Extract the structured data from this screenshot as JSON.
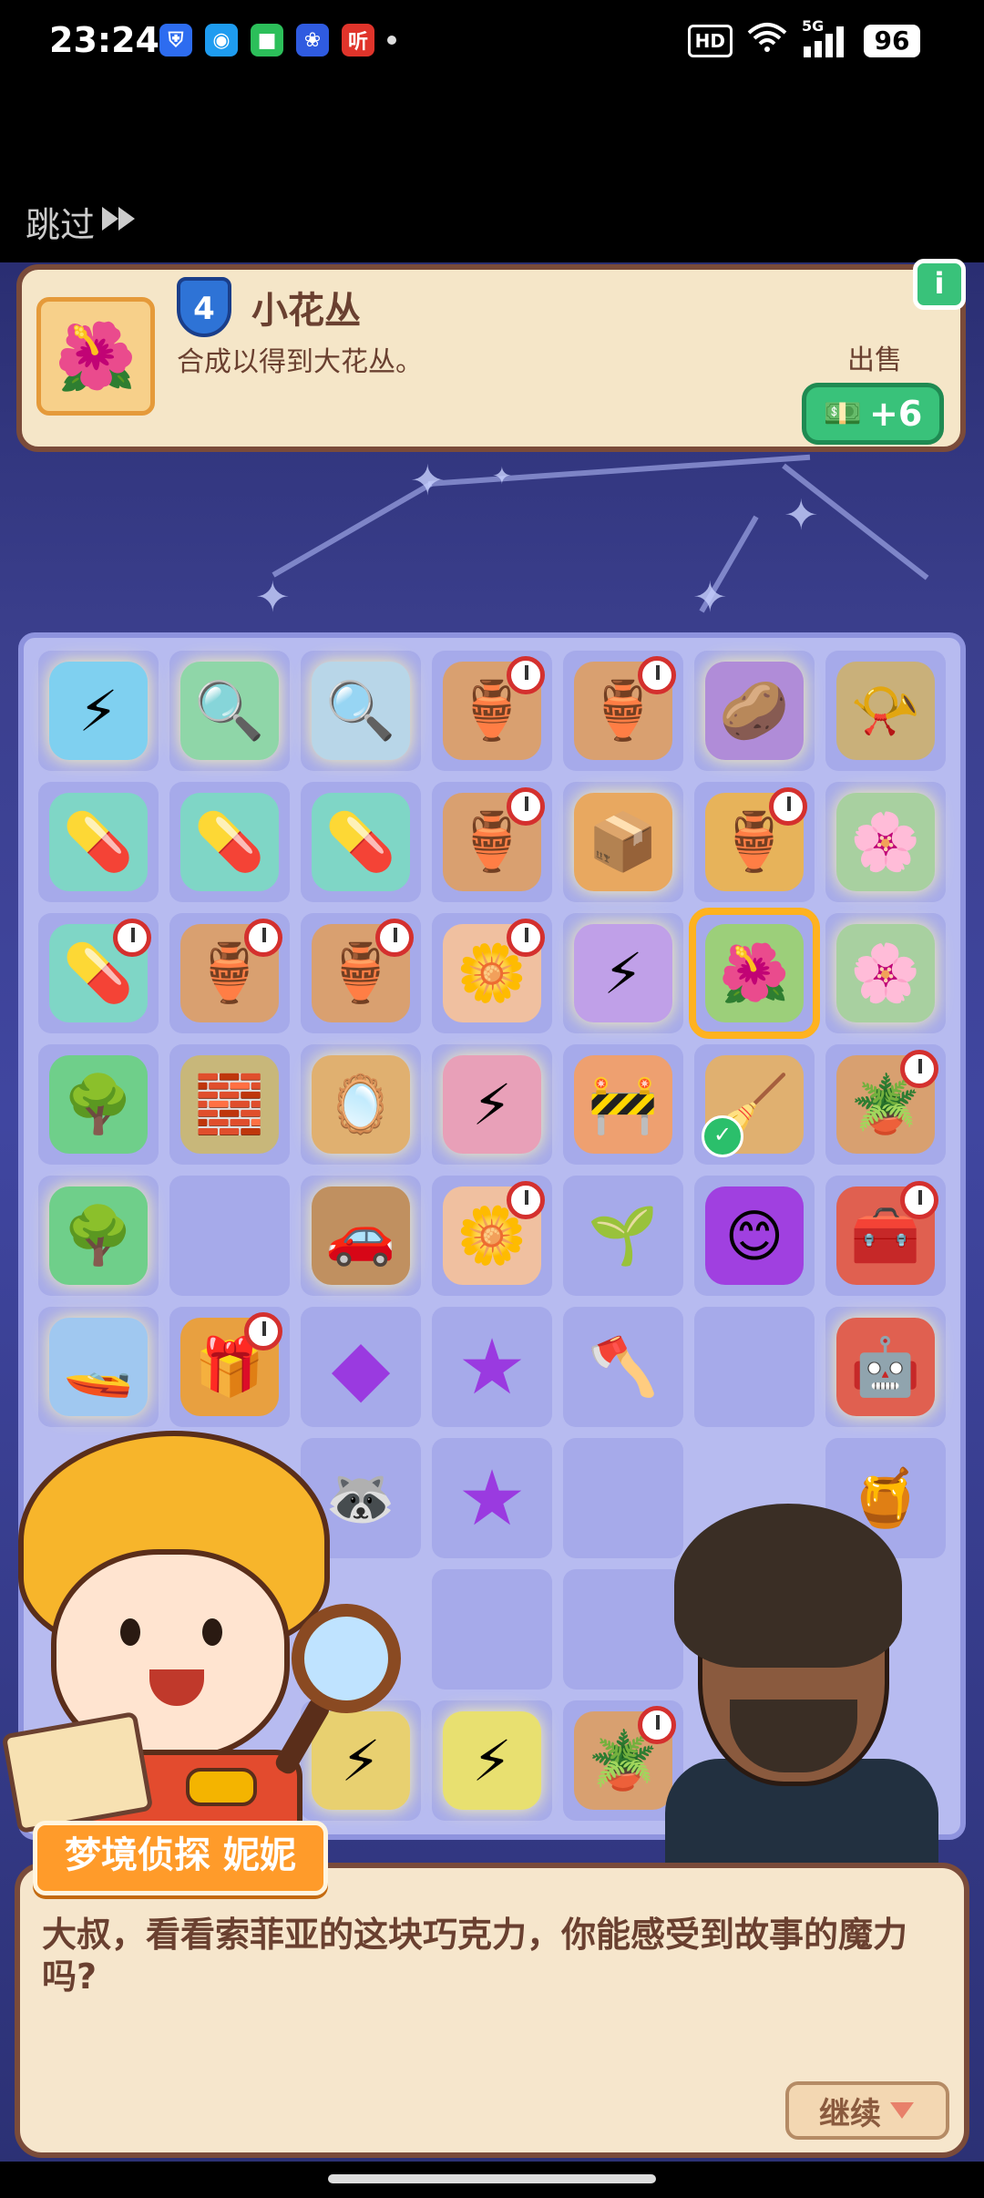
{
  "status_bar": {
    "time": "23:24",
    "hd": "HD",
    "network": "5G",
    "battery": "96",
    "apps": [
      {
        "icon": "shield-app-icon",
        "color": "#2d6cf0",
        "glyph": "⛨"
      },
      {
        "icon": "penguin-app-icon",
        "color": "#1e9cf0",
        "glyph": "◉"
      },
      {
        "icon": "chat-app-icon",
        "color": "#2cbf5a",
        "glyph": "■"
      },
      {
        "icon": "paw-app-icon",
        "color": "#2f5be0",
        "glyph": "❀"
      },
      {
        "icon": "listen-app-icon",
        "color": "#e0342b",
        "glyph": "听"
      }
    ]
  },
  "skip_label": "跳过",
  "info_panel": {
    "level": "4",
    "title": "小花丛",
    "description": "合成以得到大花丛。",
    "sell_label": "出售",
    "sell_value": "+6",
    "info_button": "i"
  },
  "board": {
    "rows": [
      [
        {
          "name": "power-crate",
          "glyph": "⚡",
          "bg": "#7fd0f0",
          "locked": true
        },
        {
          "name": "map-table",
          "glyph": "🔍",
          "bg": "#8fd6a8",
          "locked": true
        },
        {
          "name": "clue-board",
          "glyph": "🔍",
          "bg": "#b8d6e8",
          "locked": true
        },
        {
          "name": "pottery-cart",
          "glyph": "🏺",
          "bg": "#d9a070",
          "timer": true
        },
        {
          "name": "pottery-cart",
          "glyph": "🏺",
          "bg": "#d9a070",
          "timer": true
        },
        {
          "name": "potato-orb",
          "glyph": "🥔",
          "bg": "#b08cd8",
          "locked": true
        },
        {
          "name": "horn",
          "glyph": "📯",
          "bg": "#c9b07a"
        }
      ],
      [
        {
          "name": "medicine-kit",
          "glyph": "💊",
          "bg": "#7fd6c6"
        },
        {
          "name": "medicine-kit",
          "glyph": "💊",
          "bg": "#7fd6c6"
        },
        {
          "name": "medicine-kit",
          "glyph": "💊",
          "bg": "#7fd6c6"
        },
        {
          "name": "pottery-cart",
          "glyph": "🏺",
          "bg": "#d9a070",
          "timer": true
        },
        {
          "name": "crate-stack",
          "glyph": "📦",
          "bg": "#e8a860",
          "locked": true
        },
        {
          "name": "gold-vase",
          "glyph": "🏺",
          "bg": "#e7b35a",
          "timer": true
        },
        {
          "name": "pink-flower-tree",
          "glyph": "🌸",
          "bg": "#a8d0a0",
          "locked": true
        }
      ],
      [
        {
          "name": "medicine-kit",
          "glyph": "💊",
          "bg": "#7fd6c6",
          "timer": true
        },
        {
          "name": "pottery-cart",
          "glyph": "🏺",
          "bg": "#d9a070",
          "timer": true
        },
        {
          "name": "pottery-cart",
          "glyph": "🏺",
          "bg": "#d9a070",
          "timer": true
        },
        {
          "name": "flower-pot",
          "glyph": "🌼",
          "bg": "#f0c0a0",
          "timer": true
        },
        {
          "name": "power-disc",
          "glyph": "⚡",
          "bg": "#c0a0e8",
          "locked": true
        },
        {
          "name": "small-bush",
          "glyph": "🌺",
          "bg": "#9ccf7a",
          "selected": true
        },
        {
          "name": "pink-flower-tree",
          "glyph": "🌸",
          "bg": "#a8d0a0",
          "locked": true
        }
      ],
      [
        {
          "name": "blossom-tree",
          "glyph": "🌳",
          "bg": "#6fcf8a"
        },
        {
          "name": "sandbag-pile",
          "glyph": "🧱",
          "bg": "#c8b77a"
        },
        {
          "name": "mirror-pair",
          "glyph": "🪞",
          "bg": "#e0b070",
          "locked": true
        },
        {
          "name": "power-orb",
          "glyph": "⚡",
          "bg": "#e8a0b8",
          "locked": true
        },
        {
          "name": "road-barrier",
          "glyph": "🚧",
          "bg": "#eea070"
        },
        {
          "name": "broom",
          "glyph": "🧹",
          "bg": "#e0b070",
          "check": true
        },
        {
          "name": "plant-pot",
          "glyph": "🪴",
          "bg": "#d8a070",
          "timer": true
        }
      ],
      [
        {
          "name": "blossom-tree",
          "glyph": "🌳",
          "bg": "#6fcf8a",
          "locked": true
        },
        {
          "name": "empty",
          "glyph": "",
          "bg": ""
        },
        {
          "name": "toy-car",
          "glyph": "🚗",
          "bg": "#c09060",
          "locked": true
        },
        {
          "name": "flower-pot",
          "glyph": "🌼",
          "bg": "#f0c0a0",
          "timer": true
        },
        {
          "name": "sprout",
          "glyph": "🌱",
          "bg": ""
        },
        {
          "name": "purple-blob",
          "glyph": "😊",
          "bg": "#a040e0"
        },
        {
          "name": "tool-box",
          "glyph": "🧰",
          "bg": "#e06050",
          "timer": true
        }
      ],
      [
        {
          "name": "jet-ski",
          "glyph": "🚤",
          "bg": "#a0c8f0",
          "locked": true
        },
        {
          "name": "treasure-chest",
          "glyph": "🎁",
          "bg": "#e8a040",
          "timer": true
        },
        {
          "name": "purple-gem",
          "glyph": "◆",
          "bg": ""
        },
        {
          "name": "purple-star",
          "glyph": "★",
          "bg": ""
        },
        {
          "name": "axe",
          "glyph": "🪓",
          "bg": ""
        },
        {
          "name": "empty",
          "glyph": "",
          "bg": ""
        },
        {
          "name": "red-robot",
          "glyph": "🤖",
          "bg": "#e06050",
          "locked": true
        }
      ],
      [
        {
          "name": "hidden",
          "glyph": "",
          "bg": ""
        },
        {
          "name": "hidden",
          "glyph": "",
          "bg": ""
        },
        {
          "name": "red-panda",
          "glyph": "🦝",
          "bg": ""
        },
        {
          "name": "purple-star-face",
          "glyph": "★",
          "bg": ""
        },
        {
          "name": "empty",
          "glyph": "",
          "bg": ""
        },
        {
          "name": "hidden",
          "glyph": "",
          "bg": ""
        },
        {
          "name": "honey-jar",
          "glyph": "🍯",
          "bg": ""
        }
      ],
      [
        {
          "name": "hidden",
          "glyph": "",
          "bg": ""
        },
        {
          "name": "hidden",
          "glyph": "",
          "bg": ""
        },
        {
          "name": "hidden",
          "glyph": "",
          "bg": ""
        },
        {
          "name": "empty",
          "glyph": "",
          "bg": ""
        },
        {
          "name": "empty",
          "glyph": "",
          "bg": ""
        },
        {
          "name": "hidden",
          "glyph": "",
          "bg": ""
        },
        {
          "name": "hidden",
          "glyph": "",
          "bg": ""
        }
      ],
      [
        {
          "name": "hidden",
          "glyph": "",
          "bg": ""
        },
        {
          "name": "hidden",
          "glyph": "",
          "bg": ""
        },
        {
          "name": "power-crate",
          "glyph": "⚡",
          "bg": "#e8d070",
          "locked": true
        },
        {
          "name": "power-coin",
          "glyph": "⚡",
          "bg": "#e8e070",
          "locked": true
        },
        {
          "name": "plant-pot",
          "glyph": "🪴",
          "bg": "#d8a070",
          "timer": true
        },
        {
          "name": "hidden",
          "glyph": "",
          "bg": ""
        },
        {
          "name": "hidden",
          "glyph": "",
          "bg": ""
        }
      ]
    ]
  },
  "dialog": {
    "speaker": "梦境侦探 妮妮",
    "text": "大叔，看看索菲亚的这块巧克力，你能感受到故事的魔力吗?",
    "continue_label": "继续"
  }
}
